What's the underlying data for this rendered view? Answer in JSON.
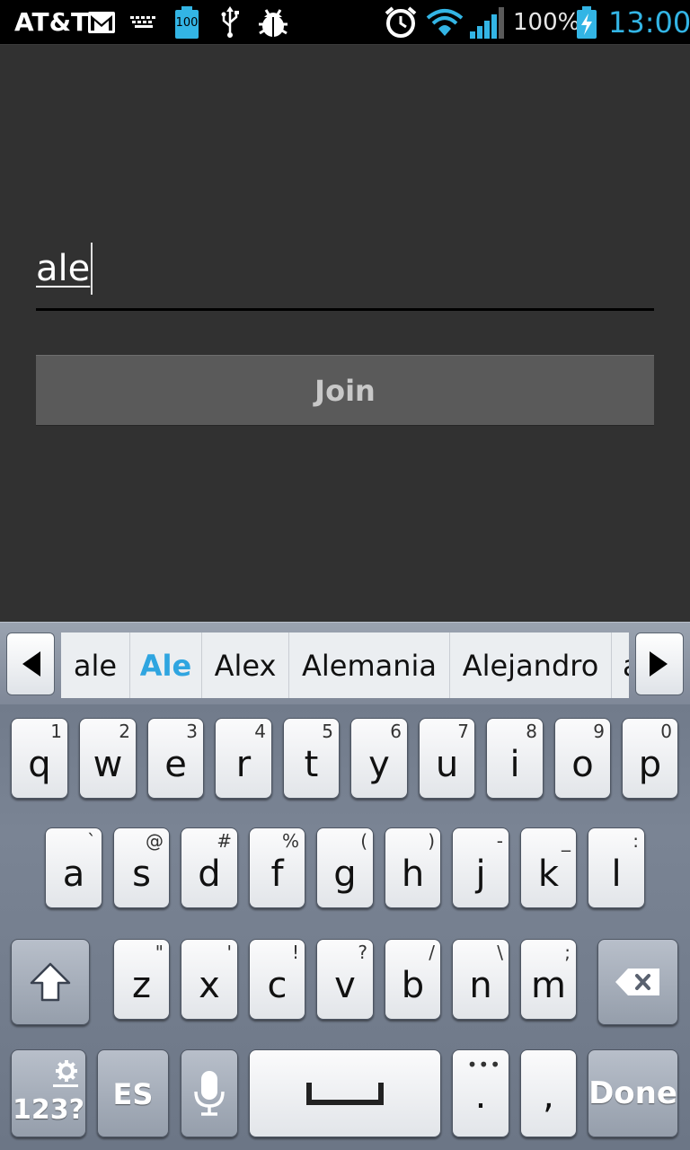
{
  "status_bar": {
    "carrier": "AT&T",
    "battery_notification": "100",
    "battery_percent": "100%",
    "time": "13:00",
    "icons": [
      "gmail-icon",
      "keyboard-icon",
      "battery-notification-icon",
      "usb-icon",
      "debug-icon",
      "alarm-icon",
      "wifi-icon",
      "signal-icon",
      "battery-charging-icon"
    ]
  },
  "form": {
    "name_value": "ale",
    "join_label": "Join"
  },
  "keyboard": {
    "suggestions": [
      "ale",
      "Ale",
      "Alex",
      "Alemania",
      "Alejandro",
      "a"
    ],
    "selected_suggestion": "Ale",
    "row1": [
      {
        "key": "q",
        "sub": "1"
      },
      {
        "key": "w",
        "sub": "2"
      },
      {
        "key": "e",
        "sub": "3"
      },
      {
        "key": "r",
        "sub": "4"
      },
      {
        "key": "t",
        "sub": "5"
      },
      {
        "key": "y",
        "sub": "6"
      },
      {
        "key": "u",
        "sub": "7"
      },
      {
        "key": "i",
        "sub": "8"
      },
      {
        "key": "o",
        "sub": "9"
      },
      {
        "key": "p",
        "sub": "0"
      }
    ],
    "row2": [
      {
        "key": "a",
        "sub": "`"
      },
      {
        "key": "s",
        "sub": "@"
      },
      {
        "key": "d",
        "sub": "#"
      },
      {
        "key": "f",
        "sub": "%"
      },
      {
        "key": "g",
        "sub": "("
      },
      {
        "key": "h",
        "sub": ")"
      },
      {
        "key": "j",
        "sub": "-"
      },
      {
        "key": "k",
        "sub": "_"
      },
      {
        "key": "l",
        "sub": ":"
      }
    ],
    "row3": [
      {
        "key": "z",
        "sub": "\""
      },
      {
        "key": "x",
        "sub": "'"
      },
      {
        "key": "c",
        "sub": "!"
      },
      {
        "key": "v",
        "sub": "?"
      },
      {
        "key": "b",
        "sub": "/"
      },
      {
        "key": "n",
        "sub": "\\"
      },
      {
        "key": "m",
        "sub": ";"
      }
    ],
    "symbols_label": "123?",
    "language_label": "ES",
    "period_label": ".",
    "comma_label": ",",
    "done_label": "Done",
    "accent_color": "#33b5e5"
  }
}
